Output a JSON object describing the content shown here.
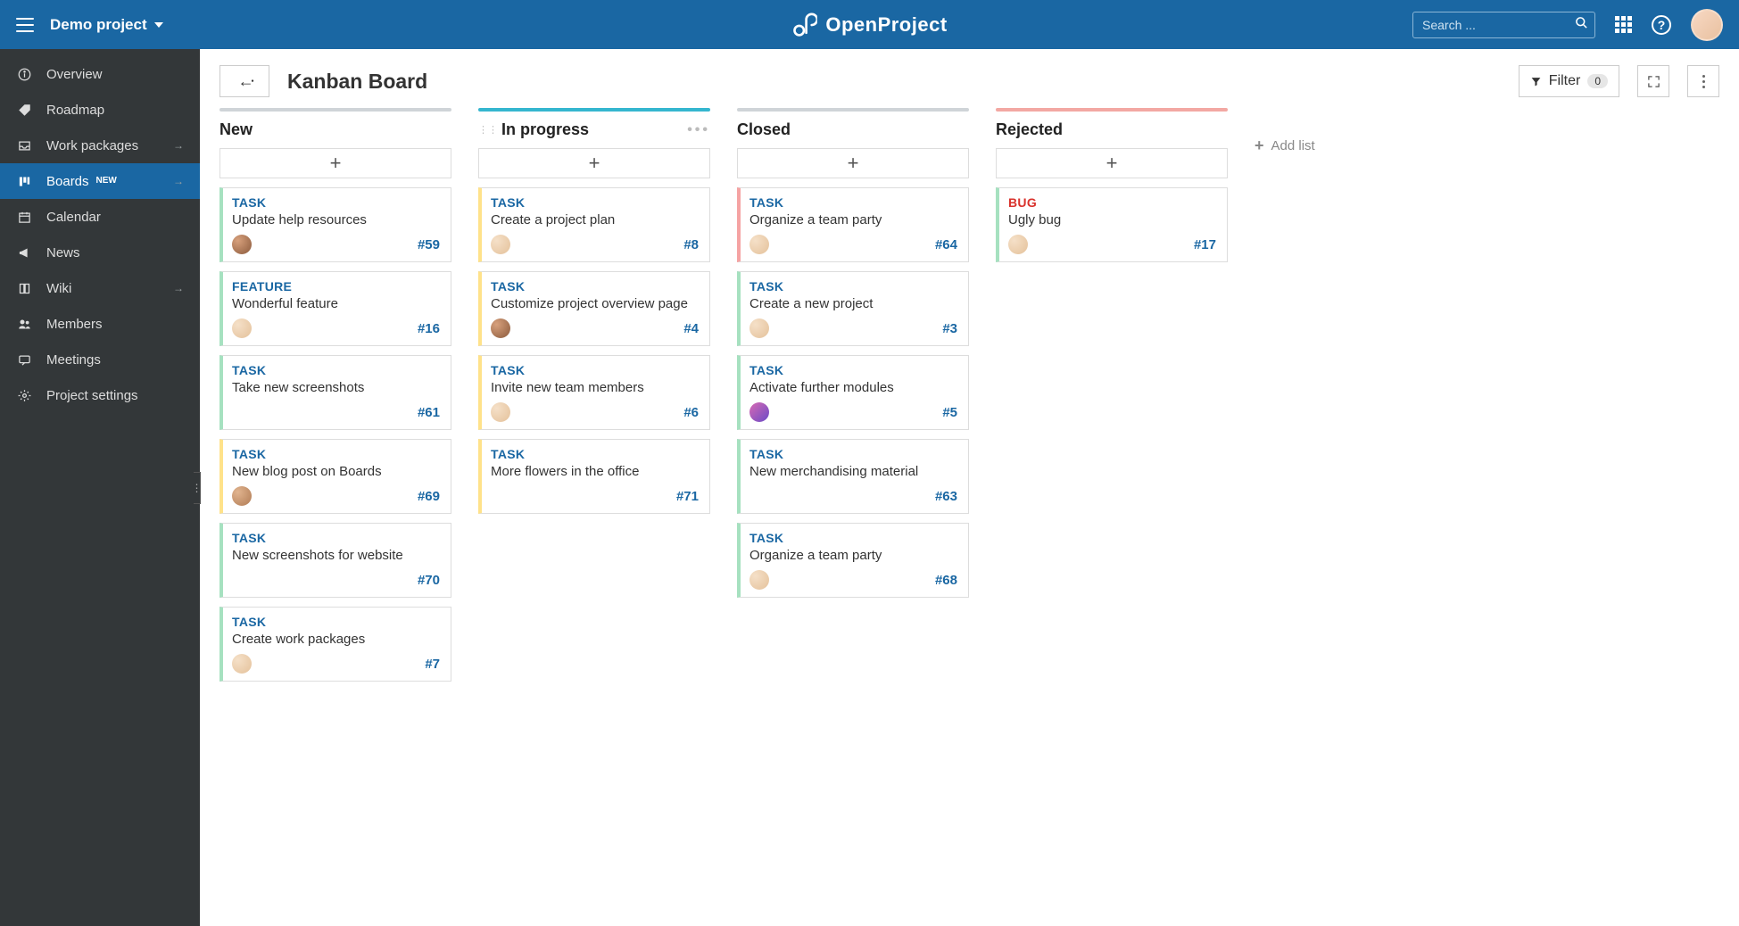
{
  "app_name": "OpenProject",
  "project_selector_label": "Demo project",
  "search": {
    "placeholder": "Search ..."
  },
  "sidebar": {
    "items": [
      {
        "label": "Overview",
        "icon": "info-icon"
      },
      {
        "label": "Roadmap",
        "icon": "tag-icon"
      },
      {
        "label": "Work packages",
        "icon": "inbox-icon",
        "has_arrow": true
      },
      {
        "label": "Boards",
        "icon": "board-icon",
        "has_arrow": true,
        "badge": "NEW",
        "active": true
      },
      {
        "label": "Calendar",
        "icon": "calendar-icon"
      },
      {
        "label": "News",
        "icon": "megaphone-icon"
      },
      {
        "label": "Wiki",
        "icon": "book-icon",
        "has_arrow": true
      },
      {
        "label": "Members",
        "icon": "users-icon"
      },
      {
        "label": "Meetings",
        "icon": "chat-icon"
      },
      {
        "label": "Project settings",
        "icon": "gear-icon"
      }
    ]
  },
  "toolbar": {
    "title": "Kanban Board",
    "filter_label": "Filter",
    "filter_count": "0",
    "add_list_label": "Add list"
  },
  "columns": [
    {
      "name": "New",
      "accent": "#cfd4d8",
      "show_drag_dots": false,
      "show_more": false,
      "cards": [
        {
          "type": "TASK",
          "type_class": "task",
          "title": "Update help resources",
          "id": "#59",
          "left": "#a6e1c0",
          "avatar": "av1"
        },
        {
          "type": "FEATURE",
          "type_class": "feature",
          "title": "Wonderful feature",
          "id": "#16",
          "left": "#a6e1c0",
          "avatar": "av2"
        },
        {
          "type": "TASK",
          "type_class": "task",
          "title": "Take new screenshots",
          "id": "#61",
          "left": "#a6e1c0",
          "avatar": "avnone"
        },
        {
          "type": "TASK",
          "type_class": "task",
          "title": "New blog post on Boards",
          "id": "#69",
          "left": "#ffe28a",
          "avatar": "av3"
        },
        {
          "type": "TASK",
          "type_class": "task",
          "title": "New screenshots for website",
          "id": "#70",
          "left": "#a6e1c0",
          "avatar": "avnone"
        },
        {
          "type": "TASK",
          "type_class": "task",
          "title": "Create work packages",
          "id": "#7",
          "left": "#a6e1c0",
          "avatar": "av2"
        }
      ]
    },
    {
      "name": "In progress",
      "accent": "#35b6cf",
      "show_drag_dots": true,
      "show_more": true,
      "cards": [
        {
          "type": "TASK",
          "type_class": "task",
          "title": "Create a project plan",
          "id": "#8",
          "left": "#ffe28a",
          "avatar": "av2"
        },
        {
          "type": "TASK",
          "type_class": "task",
          "title": "Customize project overview page",
          "id": "#4",
          "left": "#ffe28a",
          "avatar": "av1"
        },
        {
          "type": "TASK",
          "type_class": "task",
          "title": "Invite new team members",
          "id": "#6",
          "left": "#ffe28a",
          "avatar": "av2"
        },
        {
          "type": "TASK",
          "type_class": "task",
          "title": "More flowers in the office",
          "id": "#71",
          "left": "#ffe28a",
          "avatar": "avnone"
        }
      ]
    },
    {
      "name": "Closed",
      "accent": "#cfd4d8",
      "show_drag_dots": false,
      "show_more": false,
      "cards": [
        {
          "type": "TASK",
          "type_class": "task",
          "title": "Organize a team party",
          "id": "#64",
          "left": "#f5a3a3",
          "avatar": "av2"
        },
        {
          "type": "TASK",
          "type_class": "task",
          "title": "Create a new project",
          "id": "#3",
          "left": "#a6e1c0",
          "avatar": "av2"
        },
        {
          "type": "TASK",
          "type_class": "task",
          "title": "Activate further modules",
          "id": "#5",
          "left": "#a6e1c0",
          "avatar": "av4"
        },
        {
          "type": "TASK",
          "type_class": "task",
          "title": "New merchandising material",
          "id": "#63",
          "left": "#a6e1c0",
          "avatar": "avnone"
        },
        {
          "type": "TASK",
          "type_class": "task",
          "title": "Organize a team party",
          "id": "#68",
          "left": "#a6e1c0",
          "avatar": "av2"
        }
      ]
    },
    {
      "name": "Rejected",
      "accent": "#f3a8a3",
      "show_drag_dots": false,
      "show_more": false,
      "cards": [
        {
          "type": "BUG",
          "type_class": "bug",
          "title": "Ugly bug",
          "id": "#17",
          "left": "#a6e1c0",
          "avatar": "av2"
        }
      ]
    }
  ]
}
